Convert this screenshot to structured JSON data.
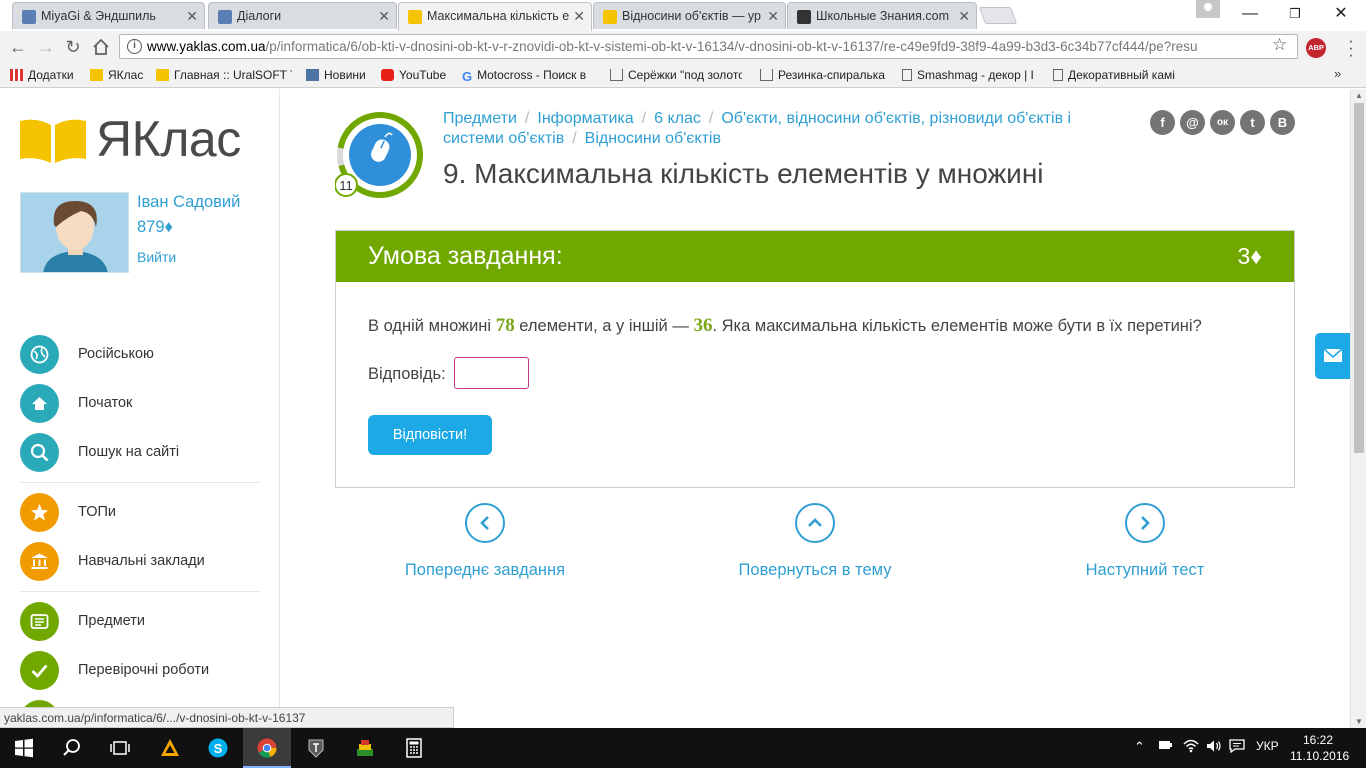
{
  "browser": {
    "tabs": [
      {
        "title": "MiyaGi & Эндшпиль",
        "favicon_color": "#5b7fb4",
        "active": false
      },
      {
        "title": "Діалоги",
        "favicon_color": "#5b7fb4",
        "active": false
      },
      {
        "title": "Максимальна кількість е",
        "favicon_color": "#f5c300",
        "active": true
      },
      {
        "title": "Відносини об'єктів — ур",
        "favicon_color": "#f5c300",
        "active": false
      },
      {
        "title": "Школьные Знания.com",
        "favicon_color": "#333333",
        "active": false
      }
    ],
    "url_host": "www.yaklas.com.ua",
    "url_path": "/p/informatica/6/ob-kti-v-dnosini-ob-kt-v-r-znovidi-ob-kt-v-sistemi-ob-kt-v-16134/v-dnosini-ob-kt-v-16137/re-c49e9fd9-38f9-4a99-b3d3-6c34b77cf444/pe?resu",
    "abp_label": "ABP",
    "bookmarks": [
      {
        "label": "Додатки",
        "icon": "apps-icon"
      },
      {
        "label": "ЯКлас",
        "icon": "folder-icon"
      },
      {
        "label": "Главная :: UralSOFT Т",
        "icon": "folder-icon"
      },
      {
        "label": "Новини",
        "icon": "vk-icon"
      },
      {
        "label": "YouTube",
        "icon": "youtube-icon"
      },
      {
        "label": "Motocross - Поиск в",
        "icon": "google-icon"
      },
      {
        "label": "Серёжки \"под золото",
        "icon": "cart-icon"
      },
      {
        "label": "Резинка-спиралька",
        "icon": "cart-icon"
      },
      {
        "label": "Smashmag - декор | I",
        "icon": "page-icon"
      },
      {
        "label": "Декоративный камі",
        "icon": "page-icon"
      }
    ],
    "bookmarks_more": "»",
    "status_url": "yaklas.com.ua/p/informatica/6/.../v-dnosini-ob-kt-v-16137"
  },
  "sidebar": {
    "logo_text": "ЯКлас",
    "user_name": "Іван Садовий",
    "user_points": "879♦",
    "logout": "Вийти",
    "items": [
      {
        "label": "Російською",
        "icon": "globe-icon",
        "color": "#2aa9b9"
      },
      {
        "label": "Початок",
        "icon": "home-icon",
        "color": "#2aa9b9"
      },
      {
        "label": "Пошук на сайті",
        "icon": "search-icon",
        "color": "#2aa9b9"
      },
      {
        "label": "ТОПи",
        "icon": "star-icon",
        "color": "#f29b00"
      },
      {
        "label": "Навчальні заклади",
        "icon": "school-icon",
        "color": "#f29b00"
      },
      {
        "label": "Предмети",
        "icon": "list-icon",
        "color": "#70a800"
      },
      {
        "label": "Перевірочні роботи",
        "icon": "check-icon",
        "color": "#70a800"
      }
    ]
  },
  "main": {
    "progress_badge": "11",
    "breadcrumbs": [
      "Предмети",
      "Інформатика",
      "6 клас",
      "Об'єкти, відносини об'єктів, різновиди об'єктів і системи об'єктів",
      "Відносини об'єктів"
    ],
    "title": "9. Максимальна кількість елементів у множині",
    "social": [
      {
        "label": "f",
        "icon": "facebook-icon"
      },
      {
        "label": "@",
        "icon": "mail-icon"
      },
      {
        "label": "ок",
        "icon": "odnoklassniki-icon"
      },
      {
        "label": "t",
        "icon": "twitter-icon"
      },
      {
        "label": "В",
        "icon": "vk-icon"
      }
    ],
    "task": {
      "heading": "Умова завдання:",
      "points": "3♦",
      "q_part1": "В одній множині ",
      "q_num1": "78",
      "q_part2": " елементи, а у іншій — ",
      "q_num2": "36",
      "q_part3": ". Яка максимальна кількість елементів може бути в їх перетині?",
      "answer_label": "Відповідь:",
      "answer_value": "",
      "submit": "Відповісти!"
    },
    "bottom_nav": {
      "prev": "Попереднє завдання",
      "up": "Повернуться в тему",
      "next": "Наступний тест"
    }
  },
  "taskbar": {
    "lang": "УКР",
    "time": "16:22",
    "date": "11.10.2016"
  }
}
